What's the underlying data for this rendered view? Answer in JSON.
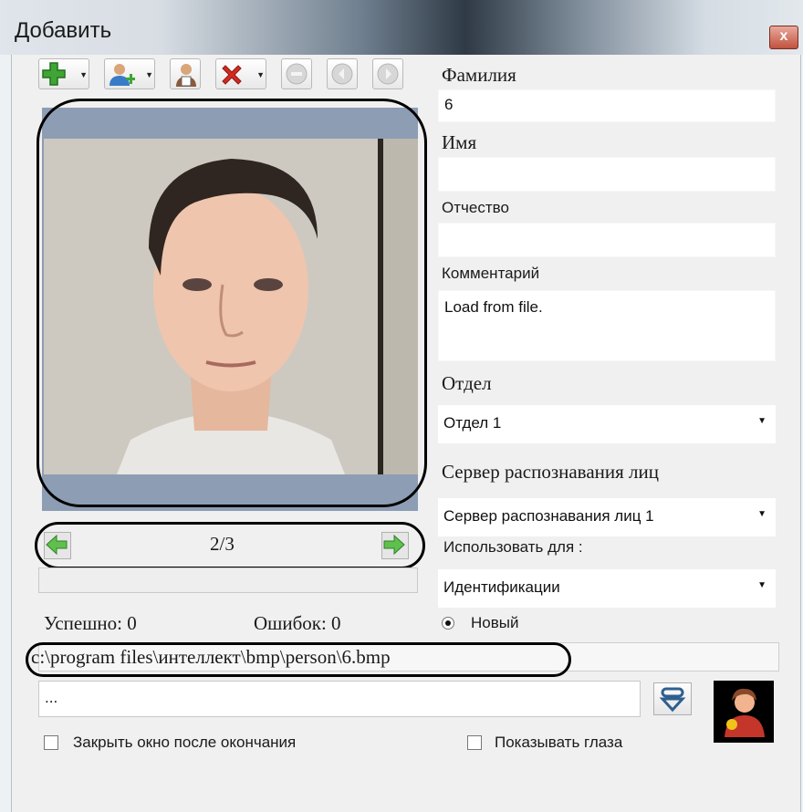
{
  "window": {
    "title": "Добавить",
    "close_glyph": "x"
  },
  "toolbar": {
    "buttons": [
      {
        "name": "add-button",
        "icon": "plus-icon",
        "dropdown": true
      },
      {
        "name": "add-person-button",
        "icon": "person-add-icon",
        "dropdown": true
      },
      {
        "name": "person-button",
        "icon": "person-icon",
        "dropdown": false
      },
      {
        "name": "delete-button",
        "icon": "delete-x-icon",
        "dropdown": true
      },
      {
        "name": "stop-button",
        "icon": "stop-icon",
        "dropdown": false
      },
      {
        "name": "back-button",
        "icon": "back-icon",
        "dropdown": false
      },
      {
        "name": "forward-button",
        "icon": "forward-icon",
        "dropdown": false
      }
    ]
  },
  "photo": {
    "counter": "2/3"
  },
  "form": {
    "surname_label": "Фамилия",
    "surname_value": "6",
    "name_label": "Имя",
    "name_value": "",
    "patronymic_label": "Отчество",
    "patronymic_value": "",
    "comment_label": "Комментарий",
    "comment_value": "Load from file.",
    "department_label": "Отдел",
    "department_value": "Отдел 1",
    "server_label": "Сервер распознавания лиц",
    "server_value": "Сервер распознавания лиц 1",
    "use_for_label": "Использовать для :",
    "use_for_value": "Идентификации",
    "new_radio_label": "Новый"
  },
  "stats": {
    "success": "Успешно: 0",
    "errors": "Ошибок: 0"
  },
  "path": {
    "value": "c:\\program files\\интеллект\\bmp\\person\\6.bmp"
  },
  "folder_field": {
    "value": "..."
  },
  "options": {
    "close_after_label": "Закрыть окно после окончания",
    "show_eyes_label": "Показывать глаза"
  },
  "colors": {
    "accent_green": "#3fa535",
    "delete_red": "#d32a1f",
    "annotation": "#000000"
  }
}
